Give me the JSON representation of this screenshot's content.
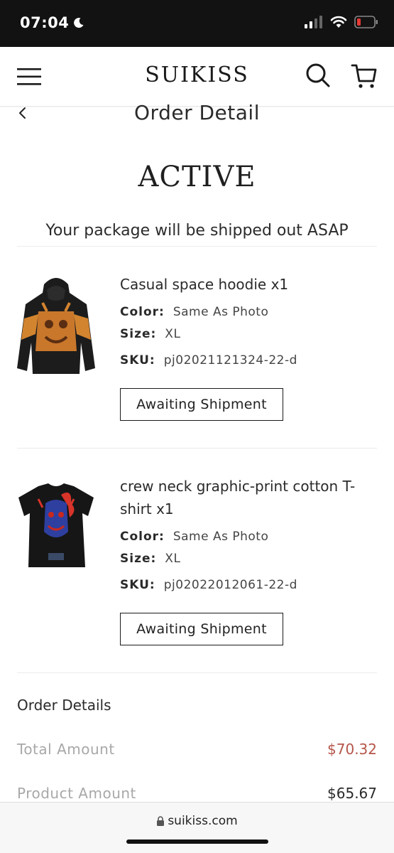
{
  "status_bar": {
    "time": "07:04",
    "icons": [
      "moon-icon",
      "cellular-icon",
      "wifi-icon",
      "battery-icon"
    ]
  },
  "header": {
    "brand": "SUIKISS",
    "icons": [
      "menu-icon",
      "search-icon",
      "cart-icon"
    ]
  },
  "page": {
    "title": "Order Detail",
    "back_icon": "chevron-left-icon",
    "order_status": "ACTIVE",
    "status_message": "Your package will be shipped out ASAP"
  },
  "items": [
    {
      "name": "Casual space hoodie x1",
      "color_label": "Color:",
      "color_value": "Same As Photo",
      "size_label": "Size:",
      "size_value": "XL",
      "sku_label": "SKU:",
      "sku_value": "pj02021121324-22-d",
      "status_button": "Awaiting Shipment"
    },
    {
      "name": "crew neck graphic-print cotton T-shirt x1",
      "color_label": "Color:",
      "color_value": "Same As Photo",
      "size_label": "Size:",
      "size_value": "XL",
      "sku_label": "SKU:",
      "sku_value": "pj02022012061-22-d",
      "status_button": "Awaiting Shipment"
    }
  ],
  "summary": {
    "heading": "Order Details",
    "total_label": "Total Amount",
    "total_value": "$70.32",
    "product_label": "Product Amount",
    "product_value": "$65.67"
  },
  "browser": {
    "url": "suikiss.com",
    "lock_icon": "lock-icon"
  },
  "colors": {
    "status_bar_bg": "#121212",
    "accent_price": "#b5554a",
    "muted_label": "#a8a8a8",
    "battery_low": "#e53935"
  }
}
